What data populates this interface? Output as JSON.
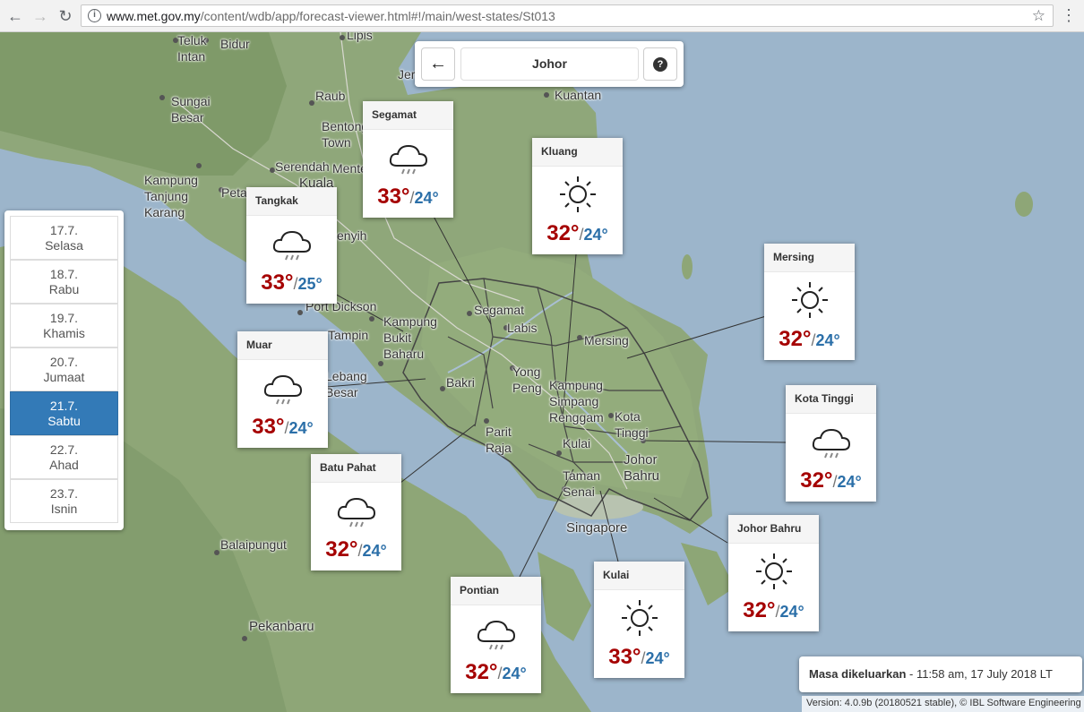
{
  "browser": {
    "url_host": "www.met.gov.my",
    "url_path": "/content/wdb/app/forecast-viewer.html#!/main/west-states/St013"
  },
  "topbar": {
    "title": "Johor"
  },
  "dates": [
    {
      "day": "17.7.",
      "name": "Selasa",
      "active": false
    },
    {
      "day": "18.7.",
      "name": "Rabu",
      "active": false
    },
    {
      "day": "19.7.",
      "name": "Khamis",
      "active": false
    },
    {
      "day": "20.7.",
      "name": "Jumaat",
      "active": false
    },
    {
      "day": "21.7.",
      "name": "Sabtu",
      "active": true
    },
    {
      "day": "22.7.",
      "name": "Ahad",
      "active": false
    },
    {
      "day": "23.7.",
      "name": "Isnin",
      "active": false
    }
  ],
  "forecasts": {
    "segamat": {
      "name": "Segamat",
      "max": "33°",
      "sep": "/",
      "min": "24°",
      "icon": "rain-cloud-icon"
    },
    "kluang": {
      "name": "Kluang",
      "max": "32°",
      "sep": "/",
      "min": "24°",
      "icon": "sun-icon"
    },
    "tangkak": {
      "name": "Tangkak",
      "max": "33°",
      "sep": "/",
      "min": "25°",
      "icon": "rain-cloud-icon"
    },
    "mersing": {
      "name": "Mersing",
      "max": "32°",
      "sep": "/",
      "min": "24°",
      "icon": "sun-icon"
    },
    "muar": {
      "name": "Muar",
      "max": "33°",
      "sep": "/",
      "min": "24°",
      "icon": "rain-cloud-icon"
    },
    "kota_tinggi": {
      "name": "Kota Tinggi",
      "max": "32°",
      "sep": "/",
      "min": "24°",
      "icon": "rain-cloud-icon"
    },
    "batu_pahat": {
      "name": "Batu Pahat",
      "max": "32°",
      "sep": "/",
      "min": "24°",
      "icon": "rain-cloud-icon"
    },
    "johor_bahru": {
      "name": "Johor Bahru",
      "max": "32°",
      "sep": "/",
      "min": "24°",
      "icon": "sun-icon"
    },
    "pontian": {
      "name": "Pontian",
      "max": "32°",
      "sep": "/",
      "min": "24°",
      "icon": "rain-cloud-icon"
    },
    "kulai": {
      "name": "Kulai",
      "max": "33°",
      "sep": "/",
      "min": "24°",
      "icon": "sun-icon"
    }
  },
  "map_labels": {
    "teluk_intan": "Teluk\nIntan",
    "bidur": "Bidur",
    "lipis": "Lipis",
    "jerantut": "Jera",
    "kuantan": "Kuantan",
    "sungai_besar": "Sungai\nBesar",
    "raub": "Raub",
    "bentong": "Bentong\nTown",
    "serendah": "Serendah",
    "mentakab": "Mente",
    "kampung_tanjung_karang": "Kampung\nTanjung\nKarang",
    "petaling": "Petal",
    "kuala": "Kuala",
    "senyih": "enyih",
    "port_dickson": "Port Dickson",
    "kampung_bukit_baharu": "Kampung\nBukit\nBaharu",
    "tampin": "Tampin",
    "segamat_map": "Segamat",
    "labis": "Labis",
    "mersing_map": "Mersing",
    "lebang_besar": "Lebang\nBesar",
    "bakri": "Bakri",
    "yong_peng": "Yong\nPeng",
    "kampung_simpang_renggam": "Kampung\nSimpang\nRenggam",
    "kota_tinggi_map": "Kota\nTinggi",
    "parit_raja": "Parit\nRaja",
    "kulai_map": "Kulai",
    "johor_bahru_map": "Johor\nBahru",
    "taman_senai": "Taman\nSenai",
    "singapore": "Singapore",
    "balaipungut": "Balaipungut",
    "pekanbaru": "Pekanbaru"
  },
  "issued": {
    "label": "Masa dikeluarkan",
    "value": " - 11:58 am, 17 July 2018 LT"
  },
  "version": "Version: 4.0.9b (20180521 stable), © IBL Software Engineering"
}
